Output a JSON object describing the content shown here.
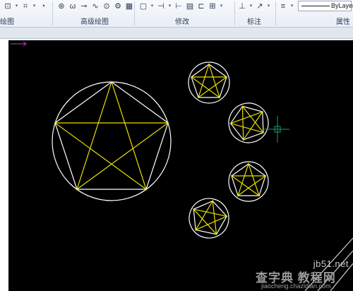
{
  "ribbon": {
    "panels": [
      {
        "id": "draw",
        "label": "绘图"
      },
      {
        "id": "advanced",
        "label": "高级绘图"
      },
      {
        "id": "modify",
        "label": "修改"
      },
      {
        "id": "annotate",
        "label": "标注"
      },
      {
        "id": "properties",
        "label": "属性"
      }
    ],
    "lineweight_value": "ByLayer"
  },
  "watermark": {
    "site": "jb51.net",
    "main": "查字典 教程网",
    "url": "jiaocheng.chazidian.com"
  },
  "colors": {
    "canvas": "#000000",
    "circle": "#ffffff",
    "star": "#e8e000",
    "ucs": "#cc33cc",
    "cursor": "#1e9e6a"
  }
}
